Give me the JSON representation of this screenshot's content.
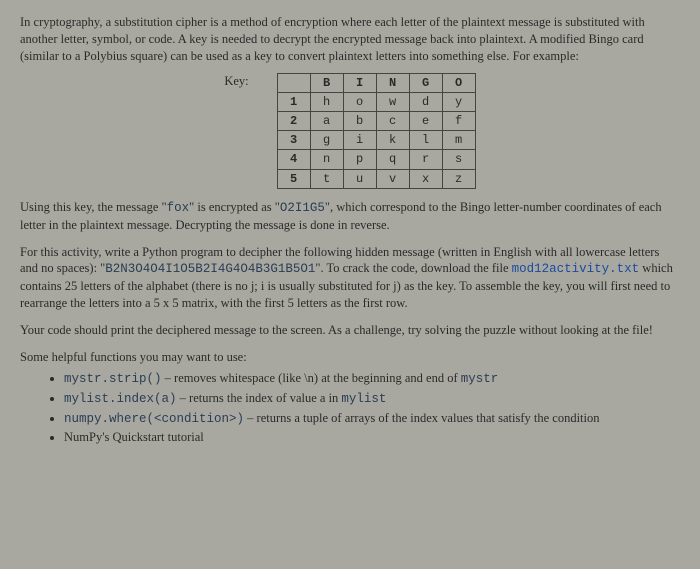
{
  "intro": "In cryptography, a substitution cipher is a method of encryption where each letter of the plaintext message is substituted with another letter, symbol, or code. A key is needed to decrypt the encrypted message back into plaintext. A modified Bingo card (similar to a Polybius square) can be used as a key to convert plaintext letters into something else. For example:",
  "key_label": "Key:",
  "bingo": {
    "cols": [
      "B",
      "I",
      "N",
      "G",
      "O"
    ],
    "rows": [
      "1",
      "2",
      "3",
      "4",
      "5"
    ],
    "cells": [
      [
        "h",
        "o",
        "w",
        "d",
        "y"
      ],
      [
        "a",
        "b",
        "c",
        "e",
        "f"
      ],
      [
        "g",
        "i",
        "k",
        "l",
        "m"
      ],
      [
        "n",
        "p",
        "q",
        "r",
        "s"
      ],
      [
        "t",
        "u",
        "v",
        "x",
        "z"
      ]
    ]
  },
  "para_key_example_pre": "Using this key, the message \"",
  "para_key_example_msg": "fox",
  "para_key_example_mid": "\" is encrypted as \"",
  "para_key_example_enc": "O2I1G5",
  "para_key_example_post": "\", which correspond to the Bingo letter-number coordinates of each letter in the plaintext message. Decrypting the message is done in reverse.",
  "para_activity_pre": "For this activity, write a Python program to decipher the following hidden message (written in English with all lowercase letters and no spaces): \"",
  "para_activity_code": "B2N3O4O4I1O5B2I4G4O4B3G1B5O1",
  "para_activity_mid1": "\". To crack the code, download the file ",
  "para_activity_link": "mod12activity.txt",
  "para_activity_mid2": " which contains 25 letters of the alphabet (there is no j; i is usually substituted for j) as the key. To assemble the key, you will first need to rearrange the letters into a 5 x 5 matrix, with the first 5 letters as the first row.",
  "para_challenge": "Your code should print the deciphered message to the screen. As a challenge, try solving the puzzle without looking at the file!",
  "hints_heading": "Some helpful functions you may want to use:",
  "hints": {
    "h1_code": "mystr.strip()",
    "h1_text": " – removes whitespace (like \\n) at the beginning and end of ",
    "h1_code2": "mystr",
    "h2_code": "mylist.index(a)",
    "h2_text": " – returns the index of value a in ",
    "h2_code2": "mylist",
    "h3_code": "numpy.where(<condition>)",
    "h3_text": " – returns a tuple of arrays of the index values that satisfy the condition",
    "h4_text": "NumPy's Quickstart tutorial"
  }
}
